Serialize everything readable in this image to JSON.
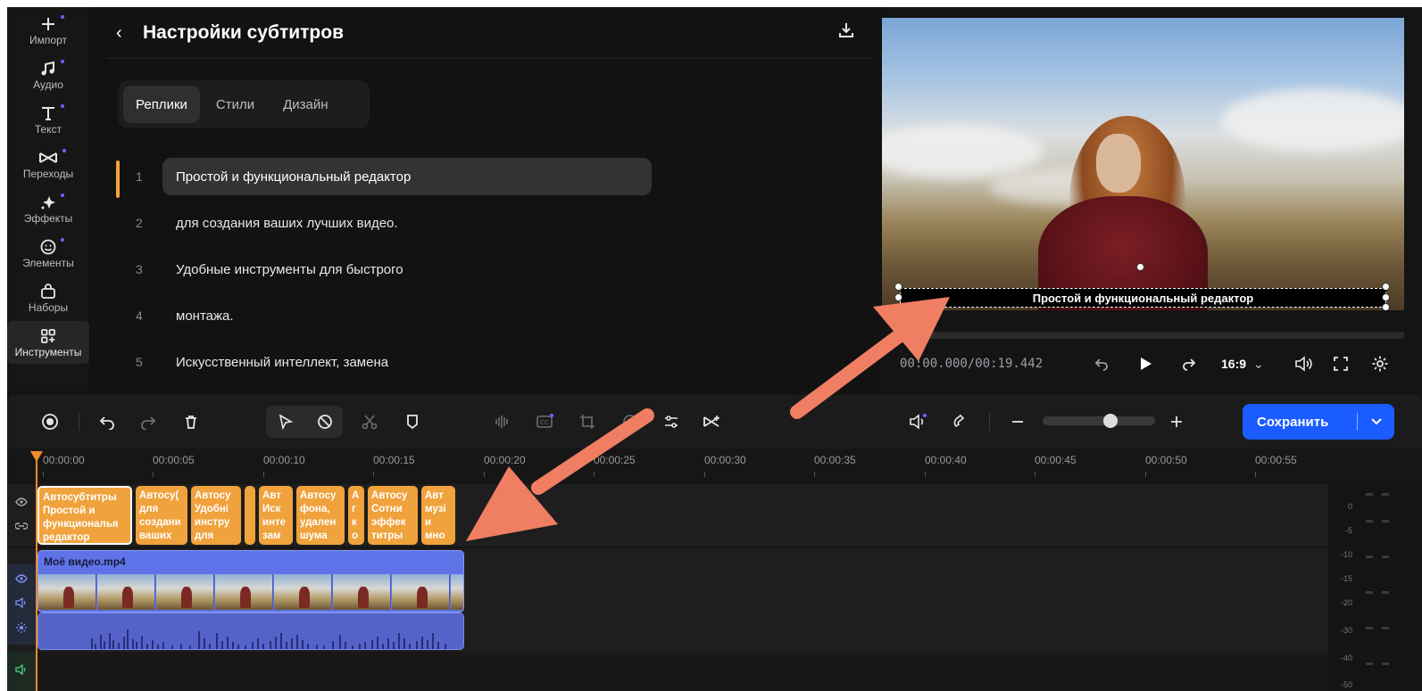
{
  "rail": [
    {
      "label": "Импорт",
      "icon": "plus-icon",
      "dot": true
    },
    {
      "label": "Аудио",
      "icon": "music-icon",
      "dot": true
    },
    {
      "label": "Текст",
      "icon": "text-icon",
      "dot": true
    },
    {
      "label": "Переходы",
      "icon": "transitions-icon",
      "dot": true
    },
    {
      "label": "Эффекты",
      "icon": "effects-icon",
      "dot": true
    },
    {
      "label": "Элементы",
      "icon": "smiley-icon",
      "dot": true
    },
    {
      "label": "Наборы",
      "icon": "bag-icon",
      "dot": false
    },
    {
      "label": "Инструменты",
      "icon": "tools-icon",
      "dot": false,
      "active": true
    }
  ],
  "panel": {
    "back_symbol": "‹",
    "title": "Настройки субтитров",
    "tabs": [
      "Реплики",
      "Стили",
      "Дизайн"
    ],
    "active_tab": "Реплики",
    "lines": [
      {
        "n": "1",
        "text": "Простой и функциональный редактор",
        "active": true
      },
      {
        "n": "2",
        "text": "для создания ваших лучших видео."
      },
      {
        "n": "3",
        "text": "Удобные инструменты для быстрого"
      },
      {
        "n": "4",
        "text": "монтажа."
      },
      {
        "n": "5",
        "text": "Искусственный интеллект, замена"
      }
    ]
  },
  "preview": {
    "subtitle": "Простой и функциональный редактор",
    "time": "00:00.000/00:19.442",
    "aspect": "16:9"
  },
  "toolbar": {
    "save_label": "Сохранить"
  },
  "ruler": [
    "00:00:00",
    "00:00:05",
    "00:00:10",
    "00:00:15",
    "00:00:20",
    "00:00:25",
    "00:00:30",
    "00:00:35",
    "00:00:40",
    "00:00:45",
    "00:00:50",
    "00:00:55"
  ],
  "subtitle_clips": [
    {
      "title": "Автосубтитры",
      "body": "Простой и\nфункциональя\nредактор",
      "first": true
    },
    {
      "title": "Автосу(",
      "body": "для\nсоздани\nваших"
    },
    {
      "title": "Автосу",
      "body": "Удобні\nинстру\nдля"
    },
    {
      "title": "",
      "body": ""
    },
    {
      "title": "Авт",
      "body": "Иск\nинте\nзам"
    },
    {
      "title": "Автосу",
      "body": "фона,\nудален\nшума"
    },
    {
      "title": "А",
      "body": "г\nк\nо"
    },
    {
      "title": "Автосу",
      "body": "Сотни\nэффек\nтитры"
    },
    {
      "title": "Авт",
      "body": "музі\nи\nмно"
    }
  ],
  "video_clip": {
    "name": "Моё видео.mp4"
  },
  "meter_labels": [
    "0",
    "-5",
    "-10",
    "-15",
    "-20",
    "-30",
    "-40",
    "-50"
  ],
  "colors": {
    "accent": "#1a5cff",
    "subtitle_clip": "#f0a23c",
    "video_clip": "#5f73e8",
    "playhead": "#f08a2c",
    "arrow": "#f07e63"
  }
}
